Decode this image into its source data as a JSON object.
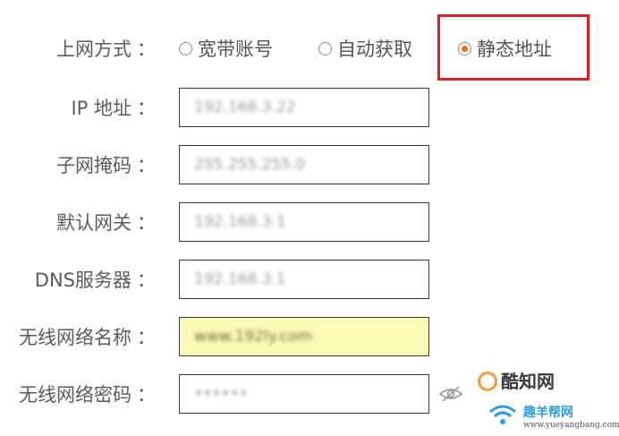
{
  "connection": {
    "label": "上网方式",
    "colon": "：",
    "options": [
      {
        "label": "宽带账号",
        "checked": false
      },
      {
        "label": "自动获取",
        "checked": false
      },
      {
        "label": "静态地址",
        "checked": true
      }
    ],
    "highlight_color": "#d6222a",
    "radio_accent": "#e8731e"
  },
  "fields": [
    {
      "label": "IP 地址",
      "value": "192.168.3.22"
    },
    {
      "label": "子网掩码",
      "value": "255.255.255.0"
    },
    {
      "label": "默认网关",
      "value": "192.168.3.1"
    },
    {
      "label": "DNS服务器",
      "value": "192.168.3.1"
    },
    {
      "label": "无线网络名称",
      "value": "www.192ly.com",
      "highlighted": true
    },
    {
      "label": "无线网络密码",
      "value": "••••••",
      "password": true
    }
  ],
  "icons": {
    "password_toggle": "eye-slash-icon"
  },
  "watermarks": [
    {
      "text": "酷知网"
    },
    {
      "text": "趣羊帮网",
      "url": "www.yueyangbang.com"
    }
  ]
}
